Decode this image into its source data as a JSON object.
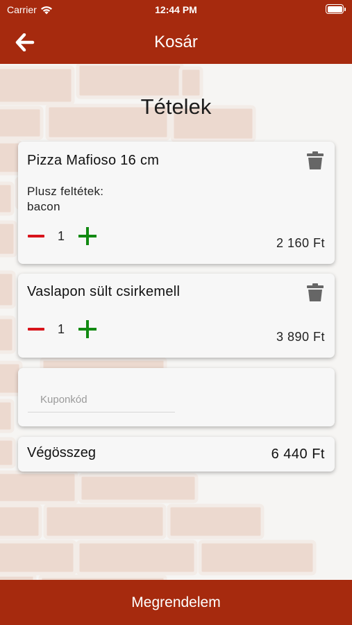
{
  "status_bar": {
    "carrier": "Carrier",
    "time": "12:44 PM"
  },
  "nav": {
    "title": "Kosár",
    "back_icon": "arrow-left-icon"
  },
  "page": {
    "title": "Tételek"
  },
  "cart": {
    "items": [
      {
        "name": "Pizza Mafioso 16 cm",
        "extras_label": "Plusz feltétek:",
        "extras_value": "bacon",
        "quantity": "1",
        "price": "2 160 Ft"
      },
      {
        "name": "Vaslapon sült csirkemell",
        "quantity": "1",
        "price": "3 890 Ft"
      }
    ],
    "coupon": {
      "placeholder": "Kuponkód",
      "value": ""
    },
    "total": {
      "label": "Végösszeg",
      "value": "6 440 Ft"
    }
  },
  "footer": {
    "order_label": "Megrendelem"
  },
  "colors": {
    "brand": "#a62a0e",
    "minus": "#d8141b",
    "plus": "#128a12",
    "icon": "#666666"
  }
}
